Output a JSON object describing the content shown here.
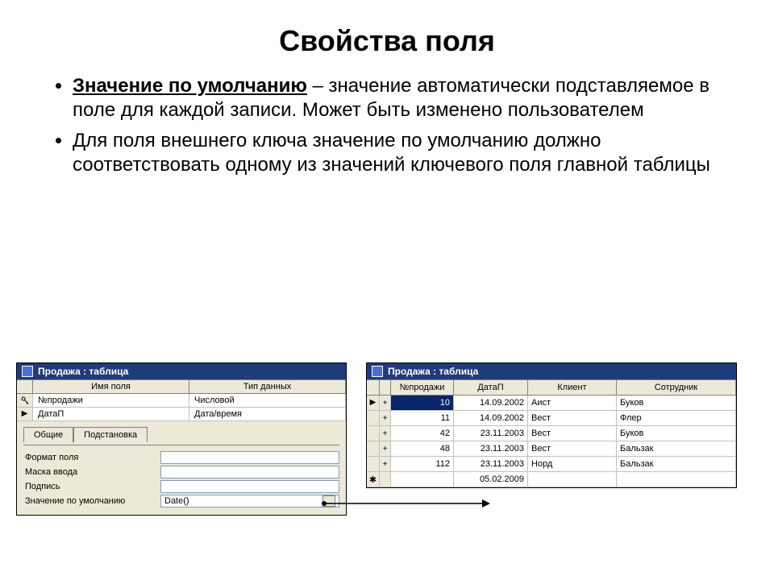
{
  "title": "Свойства поля",
  "bullets": [
    {
      "term": "Значение по умолчанию",
      "rest": " – значение автоматически подставляемое в поле для каждой записи. Может быть изменено пользователем"
    },
    {
      "term": null,
      "rest": "Для поля внешнего ключа значение по умолчанию должно соответствовать одному из значений ключевого поля главной таблицы"
    }
  ],
  "left_window": {
    "title": "Продажа : таблица",
    "columns": [
      "Имя поля",
      "Тип данных"
    ],
    "rows": [
      {
        "marker": "key",
        "name": "№продажи",
        "type": "Числовой"
      },
      {
        "marker": "arrow",
        "name": "ДатаП",
        "type": "Дата/время"
      }
    ],
    "tabs": [
      "Общие",
      "Подстановка"
    ],
    "active_tab": "Общие",
    "props": [
      {
        "label": "Формат поля",
        "value": ""
      },
      {
        "label": "Маска ввода",
        "value": ""
      },
      {
        "label": "Подпись",
        "value": ""
      },
      {
        "label": "Значение по умолчанию",
        "value": "Date()",
        "builder": true
      }
    ]
  },
  "right_window": {
    "title": "Продажа : таблица",
    "columns": [
      "№продажи",
      "ДатаП",
      "Клиент",
      "Сотрудник"
    ],
    "rows": [
      {
        "marker": "arrow",
        "id": "10",
        "date": "14.09.2002",
        "client": "Аист",
        "emp": "Буков",
        "selected": true
      },
      {
        "marker": "",
        "id": "11",
        "date": "14.09.2002",
        "client": "Вест",
        "emp": "Флер"
      },
      {
        "marker": "",
        "id": "42",
        "date": "23.11.2003",
        "client": "Вест",
        "emp": "Буков"
      },
      {
        "marker": "",
        "id": "48",
        "date": "23.11.2003",
        "client": "Вест",
        "emp": "Бальзак"
      },
      {
        "marker": "",
        "id": "112",
        "date": "23.11.2003",
        "client": "Норд",
        "emp": "Бальзак"
      },
      {
        "marker": "star",
        "id": "",
        "date": "05.02.2009",
        "client": "",
        "emp": ""
      }
    ]
  },
  "builder_button": "…"
}
